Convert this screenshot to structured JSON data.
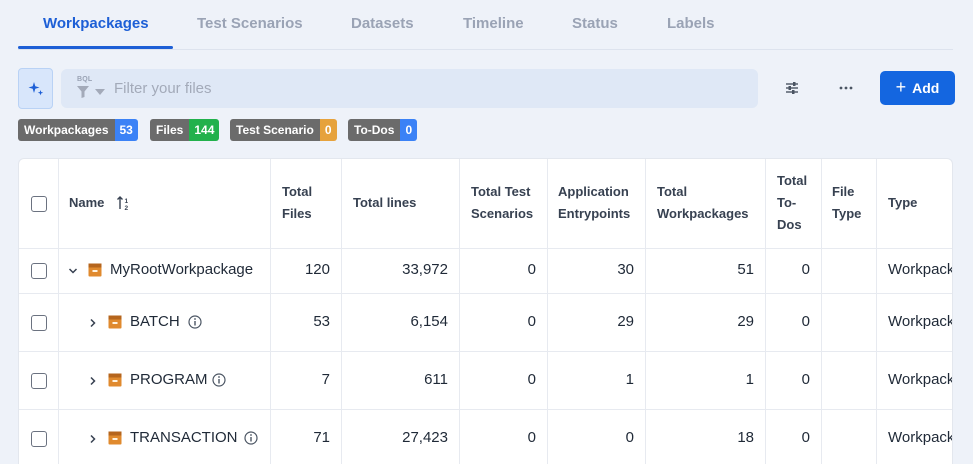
{
  "tabs": [
    {
      "label": "Workpackages"
    },
    {
      "label": "Test Scenarios"
    },
    {
      "label": "Datasets"
    },
    {
      "label": "Timeline"
    },
    {
      "label": "Status"
    },
    {
      "label": "Labels"
    }
  ],
  "filter": {
    "bql_label": "BQL",
    "placeholder": "Filter your files"
  },
  "toolbar": {
    "add_label": "Add",
    "ai_icon": "sparkle-icon",
    "settings_icon": "sliders-icon",
    "more_icon": "more-horizontal-icon"
  },
  "badges": [
    {
      "label": "Workpackages",
      "count": "53",
      "color": "#3b82f6"
    },
    {
      "label": "Files",
      "count": "144",
      "color": "#22b14c"
    },
    {
      "label": "Test Scenario",
      "count": "0",
      "color": "#e6a23c"
    },
    {
      "label": "To-Dos",
      "count": "0",
      "color": "#3b82f6"
    }
  ],
  "table": {
    "headers": {
      "name": "Name",
      "total_files": [
        "Total",
        "Files"
      ],
      "total_lines": "Total lines",
      "total_test_scenarios": [
        "Total Test",
        "Scenarios"
      ],
      "application_entrypoints": [
        "Application",
        "Entrypoints"
      ],
      "total_workpackages": [
        "Total",
        "Workpackages"
      ],
      "total_todos": [
        "Total",
        "To-",
        "Dos"
      ],
      "file_type": [
        "File",
        "Type"
      ],
      "type": "Type"
    },
    "rows": [
      {
        "name": "MyRootWorkpackage",
        "total_files": "120",
        "total_lines": "33,972",
        "total_test_scenarios": "0",
        "application_entrypoints": "30",
        "total_workpackages": "51",
        "total_todos": "0",
        "file_type": "",
        "type": "Workpackage",
        "expanded": true,
        "info": false
      },
      {
        "name": "BATCH",
        "total_files": "53",
        "total_lines": "6,154",
        "total_test_scenarios": "0",
        "application_entrypoints": "29",
        "total_workpackages": "29",
        "total_todos": "0",
        "file_type": "",
        "type": "Workpackage",
        "expanded": false,
        "info": true
      },
      {
        "name": "PROGRAM",
        "total_files": "7",
        "total_lines": "611",
        "total_test_scenarios": "0",
        "application_entrypoints": "1",
        "total_workpackages": "1",
        "total_todos": "0",
        "file_type": "",
        "type": "Workpackage",
        "expanded": false,
        "info": true
      },
      {
        "name": "TRANSACTION",
        "total_files": "71",
        "total_lines": "27,423",
        "total_test_scenarios": "0",
        "application_entrypoints": "0",
        "total_workpackages": "18",
        "total_todos": "0",
        "file_type": "",
        "type": "Workpackage",
        "expanded": false,
        "info": true
      }
    ]
  }
}
